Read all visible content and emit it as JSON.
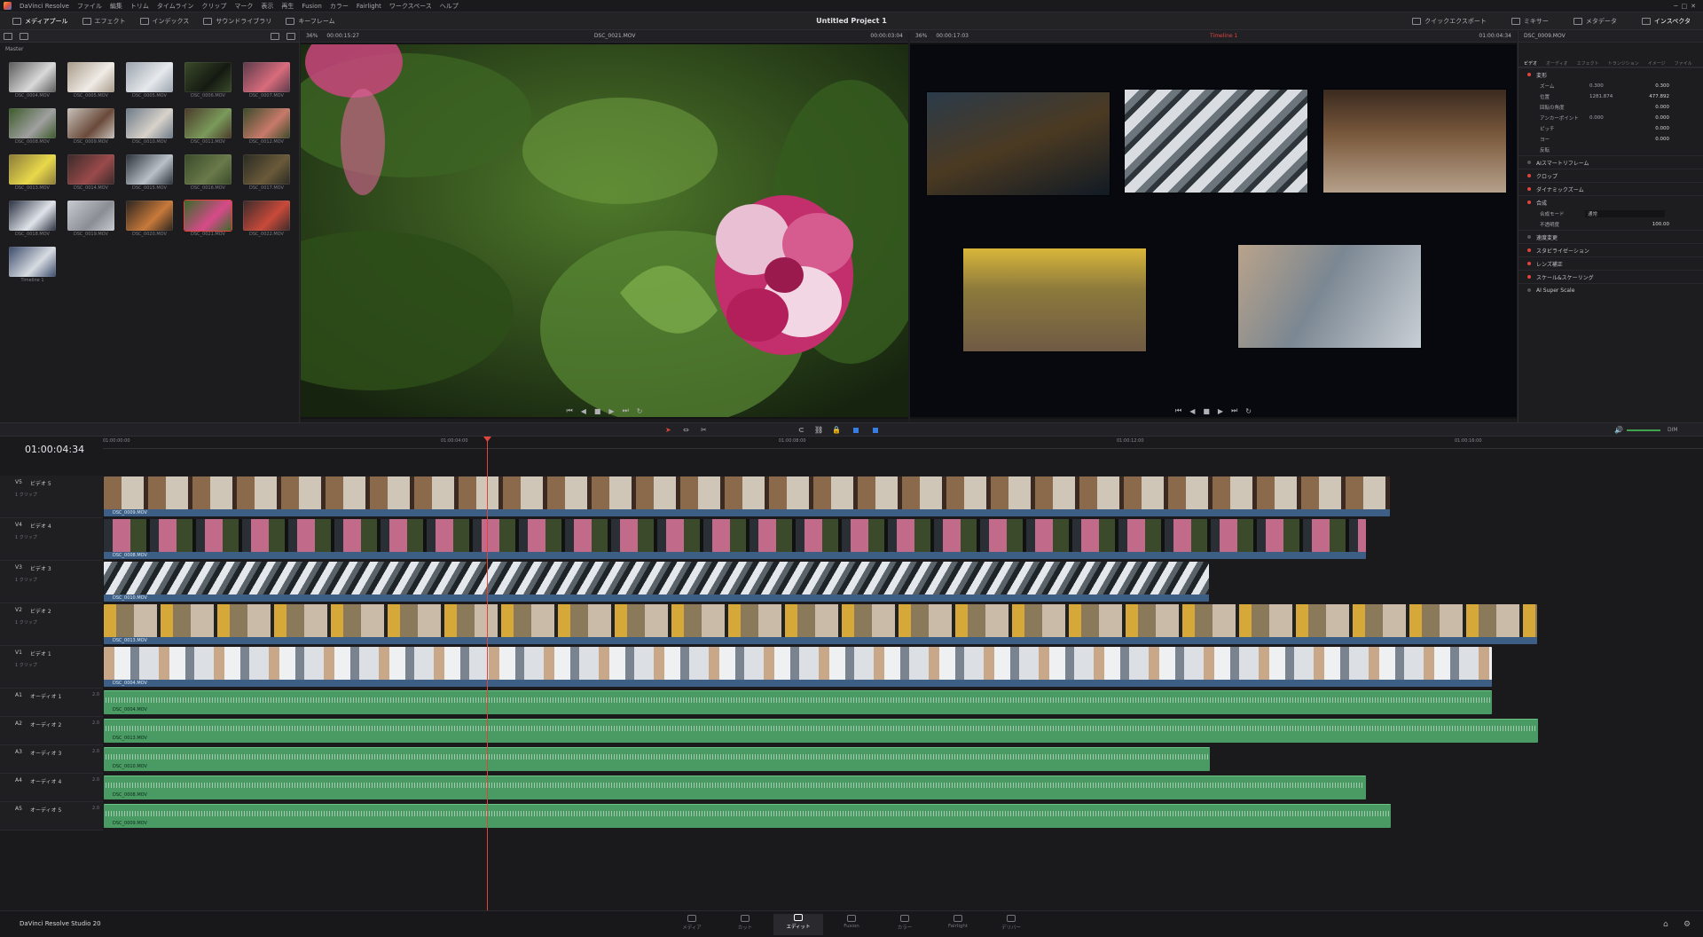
{
  "menubar": {
    "app": "DaVinci Resolve",
    "items": [
      "ファイル",
      "編集",
      "トリム",
      "タイムライン",
      "クリップ",
      "マーク",
      "表示",
      "再生",
      "Fusion",
      "カラー",
      "Fairlight",
      "ワークスペース",
      "ヘルプ"
    ]
  },
  "toolbar": {
    "left": [
      "メディアプール",
      "エフェクト",
      "インデックス",
      "サウンドライブラリ",
      "キーフレーム"
    ],
    "title": "Untitled Project 1",
    "right": [
      "クイックエクスポート",
      "ミキサー",
      "メタデータ",
      "インスペクタ"
    ]
  },
  "media_pool": {
    "folder": "Master",
    "clips": [
      "DSC_0004.MOV",
      "DSC_0005.MOV",
      "DSC_0005.MOV",
      "DSC_0006.MOV",
      "DSC_0007.MOV",
      "DSC_0008.MOV",
      "DSC_0009.MOV",
      "DSC_0010.MOV",
      "DSC_0011.MOV",
      "DSC_0012.MOV",
      "DSC_0013.MOV",
      "DSC_0014.MOV",
      "DSC_0015.MOV",
      "DSC_0016.MOV",
      "DSC_0017.MOV",
      "DSC_0018.MOV",
      "DSC_0019.MOV",
      "DSC_0020.MOV",
      "DSC_0021.MOV",
      "DSC_0022.MOV",
      "Timeline 1"
    ]
  },
  "source_viewer": {
    "zoom": "36%",
    "duration": "00:00:15:27",
    "clip": "DSC_0021.MOV",
    "timecode": "00:00:03:04"
  },
  "timeline_viewer": {
    "zoom": "36%",
    "duration": "00:00:17:03",
    "name": "Timeline 1",
    "timecode": "01:00:04:34"
  },
  "inspector": {
    "clip": "DSC_0009.MOV",
    "tabs": [
      "ビデオ",
      "オーディオ",
      "エフェクト",
      "トランジション",
      "イメージ",
      "ファイル"
    ],
    "transform": {
      "label": "変形",
      "zoom_label": "ズーム",
      "zoom_x": "0.300",
      "zoom_y": "0.300",
      "position_label": "位置",
      "position_x": "1281.874",
      "position_y": "477.892",
      "rotation_label": "回転の角度",
      "rotation": "0.000",
      "anchor_label": "アンカーポイント",
      "anchor_x": "0.000",
      "anchor_y": "0.000",
      "pitch_label": "ピッチ",
      "pitch": "0.000",
      "yaw_label": "ヨー",
      "yaw": "0.000",
      "flip_label": "反転"
    },
    "sections": [
      "AIスマートリフレーム",
      "クロップ",
      "ダイナミックズーム",
      "合成",
      "速度変更",
      "スタビライゼーション",
      "レンズ補正",
      "スケール&スケーリング",
      "AI Super Scale"
    ],
    "composite": {
      "mode_label": "合成モード",
      "mode": "通常",
      "opacity_label": "不透明度",
      "opacity": "100.00"
    }
  },
  "timeline": {
    "timecode": "01:00:04:34",
    "ruler": [
      "01:00:00:00",
      "01:00:04:00",
      "01:00:08:00",
      "01:00:12:00",
      "01:00:16:00"
    ],
    "video_tracks": [
      {
        "id": "V5",
        "name": "ビデオ 5",
        "sub": "1 クリップ",
        "clip": "DSC_0009.MOV"
      },
      {
        "id": "V4",
        "name": "ビデオ 4",
        "sub": "1 クリップ",
        "clip": "DSC_0008.MOV"
      },
      {
        "id": "V3",
        "name": "ビデオ 3",
        "sub": "1 クリップ",
        "clip": "DSC_0010.MOV"
      },
      {
        "id": "V2",
        "name": "ビデオ 2",
        "sub": "1 クリップ",
        "clip": "DSC_0013.MOV"
      },
      {
        "id": "V1",
        "name": "ビデオ 1",
        "sub": "1 クリップ",
        "clip": "DSC_0004.MOV"
      }
    ],
    "audio_tracks": [
      {
        "id": "A1",
        "name": "オーディオ 1",
        "ch": "2.0",
        "clip": "DSC_0004.MOV"
      },
      {
        "id": "A2",
        "name": "オーディオ 2",
        "ch": "2.0",
        "clip": "DSC_0013.MOV"
      },
      {
        "id": "A3",
        "name": "オーディオ 3",
        "ch": "2.0",
        "clip": "DSC_0010.MOV"
      },
      {
        "id": "A4",
        "name": "オーディオ 4",
        "ch": "2.0",
        "clip": "DSC_0008.MOV"
      },
      {
        "id": "A5",
        "name": "オーディオ 5",
        "ch": "2.0",
        "clip": "DSC_0009.MOV"
      }
    ],
    "volume": "DIM"
  },
  "footer": {
    "brand": "DaVinci Resolve Studio 20"
  },
  "pages": [
    "メディア",
    "カット",
    "エディット",
    "Fusion",
    "カラー",
    "Fairlight",
    "デリバー"
  ],
  "colors": {
    "accent": "#e0443c",
    "video_clip": "#3d5f86",
    "audio_clip": "#4a9a64"
  }
}
